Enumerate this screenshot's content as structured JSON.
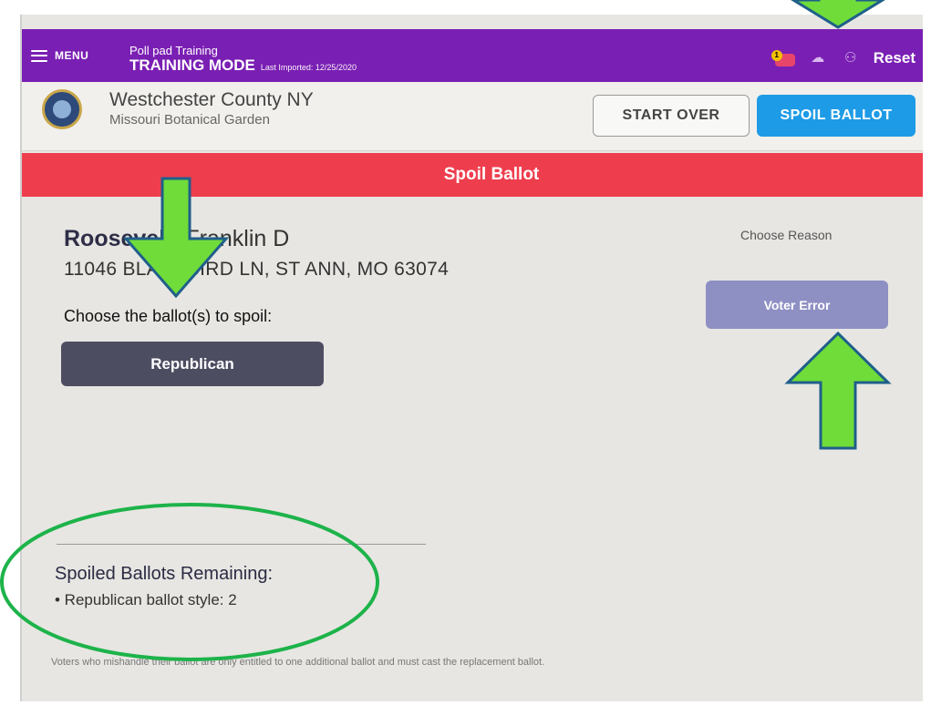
{
  "topbar": {
    "menu_label": "MENU",
    "app_name": "Poll pad Training",
    "mode": "TRAINING MODE",
    "last_imported": "Last Imported: 12/25/2020",
    "notification_count": "1",
    "reset_label": "Reset"
  },
  "header": {
    "county": "Westchester County NY",
    "location": "Missouri Botanical Garden",
    "start_over_label": "START OVER",
    "spoil_ballot_label": "SPOIL BALLOT"
  },
  "banner": {
    "title": "Spoil Ballot"
  },
  "voter": {
    "last_name": "Roosevelt",
    "first_name": "Franklin D",
    "address": "11046 BLACKBIRD LN, ST ANN, MO 63074"
  },
  "ballot_selection": {
    "label": "Choose the ballot(s) to spoil:",
    "options": [
      "Republican"
    ]
  },
  "reason": {
    "label": "Choose Reason",
    "options": [
      "Voter Error"
    ]
  },
  "remaining": {
    "title": "Spoiled Ballots Remaining:",
    "items": [
      "• Republican ballot style: 2"
    ]
  },
  "footnote": "Voters who mishandle their ballot are only entitled to one additional ballot and must cast the replacement ballot.",
  "colors": {
    "topbar": "#7a1fb3",
    "banner": "#ee3e4e",
    "primary_button": "#1e9be6",
    "ballot_button": "#4d4d62",
    "reason_button": "#8e8fc3",
    "annotation_arrow": "#6fdc3a",
    "annotation_circle": "#1db34a"
  }
}
